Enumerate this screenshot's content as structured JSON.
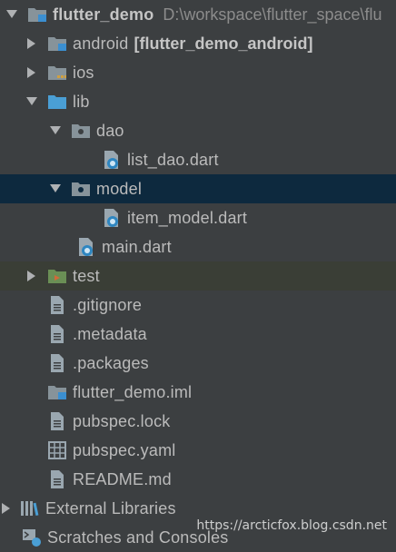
{
  "tree": {
    "root": {
      "name": "flutter_demo",
      "path": "D:\\workspace\\flutter_space\\flu"
    },
    "android": {
      "name": "android",
      "suffix": "[flutter_demo_android]"
    },
    "ios": {
      "name": "ios"
    },
    "lib": {
      "name": "lib"
    },
    "dao": {
      "name": "dao"
    },
    "list_dao": {
      "name": "list_dao.dart"
    },
    "model": {
      "name": "model"
    },
    "item_model": {
      "name": "item_model.dart"
    },
    "main": {
      "name": "main.dart"
    },
    "test": {
      "name": "test"
    },
    "gitignore": {
      "name": ".gitignore"
    },
    "metadata": {
      "name": ".metadata"
    },
    "packages": {
      "name": ".packages"
    },
    "iml": {
      "name": "flutter_demo.iml"
    },
    "lock": {
      "name": "pubspec.lock"
    },
    "yaml": {
      "name": "pubspec.yaml"
    },
    "readme": {
      "name": "README.md"
    },
    "external_libraries": {
      "name": "External Libraries"
    },
    "scratches": {
      "name": "Scratches and Consoles"
    }
  },
  "watermark": "https://arcticfox.blog.csdn.net",
  "colors": {
    "background": "#3c3f41",
    "selection": "#0d293e",
    "folder": "#87939a",
    "file": "#9aa7b0",
    "dart_badge": "#2e86c1"
  }
}
